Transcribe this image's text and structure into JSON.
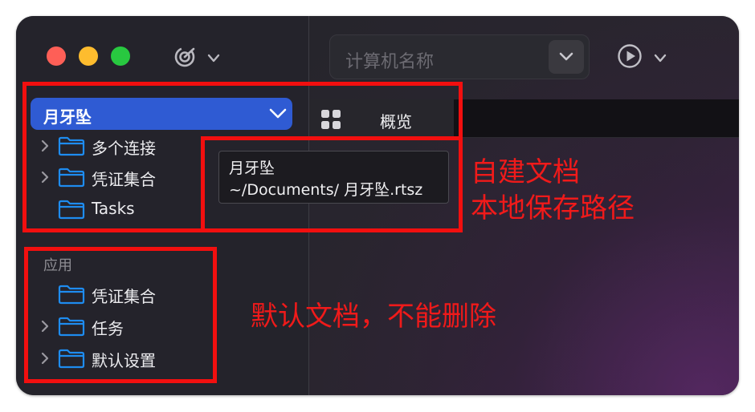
{
  "toolbar": {
    "search_placeholder": "计算机名称"
  },
  "sidebar": {
    "document": {
      "name": "月牙坠",
      "items": [
        {
          "label": "多个连接",
          "expandable": true
        },
        {
          "label": "凭证集合",
          "expandable": true
        },
        {
          "label": "Tasks",
          "expandable": false
        }
      ]
    },
    "app_section": {
      "header": "应用",
      "items": [
        {
          "label": "凭证集合",
          "expandable": false
        },
        {
          "label": "任务",
          "expandable": true
        },
        {
          "label": "默认设置",
          "expandable": true
        }
      ]
    }
  },
  "tabs": [
    {
      "label": "概览",
      "icon": "grid-icon",
      "selected": true
    }
  ],
  "tooltip": {
    "title": "月牙坠",
    "path": "~/Documents/ 月牙坠.rtsz"
  },
  "annotations": {
    "custom_doc_line1": "自建文档",
    "custom_doc_line2": "本地保存路径",
    "default_doc": "默认文档，不能删除",
    "color": "#f20f0f"
  },
  "colors": {
    "accent": "#2f5bd3",
    "folder_icon": "#1e8cf0",
    "traffic_red": "#fe5f57",
    "traffic_yellow": "#febc2e",
    "traffic_green": "#28c840"
  }
}
